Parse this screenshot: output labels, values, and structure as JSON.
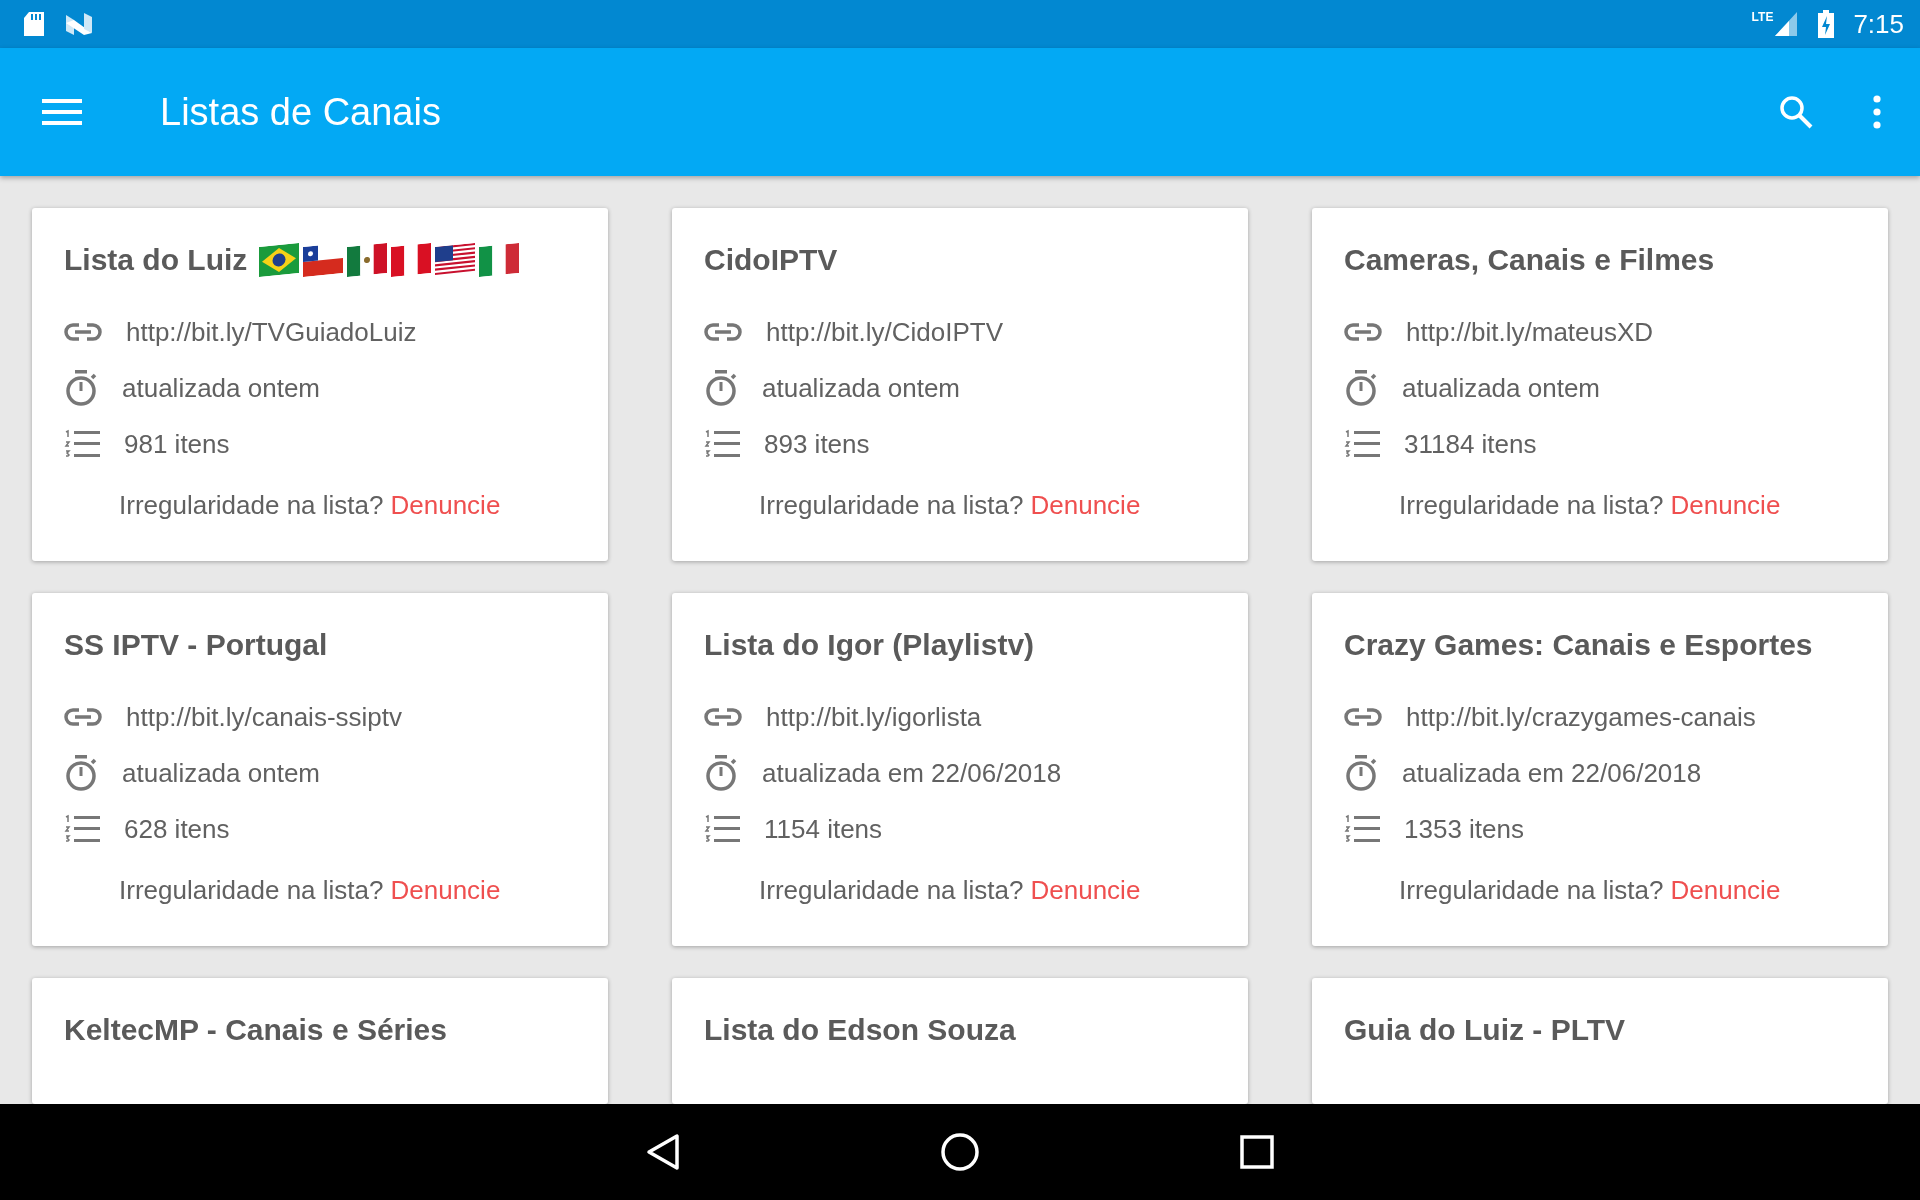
{
  "status_bar": {
    "time": "7:15",
    "network": "LTE"
  },
  "app_bar": {
    "title": "Listas de Canais"
  },
  "cards": [
    {
      "title": "Lista do Luiz",
      "flags": [
        {
          "kind": "brazil"
        },
        {
          "kind": "chile"
        },
        {
          "kind": "mexico"
        },
        {
          "kind": "peru"
        },
        {
          "kind": "usa"
        },
        {
          "kind": "italy"
        }
      ],
      "url": "http://bit.ly/TVGuiadoLuiz",
      "updated": "atualizada ontem",
      "items": "981 itens",
      "report_text": "Irregularidade na lista?",
      "report_link": "Denuncie"
    },
    {
      "title": "CidoIPTV",
      "url": "http://bit.ly/CidoIPTV",
      "updated": "atualizada ontem",
      "items": "893 itens",
      "report_text": "Irregularidade na lista?",
      "report_link": "Denuncie"
    },
    {
      "title": "Cameras, Canais e Filmes",
      "url": "http://bit.ly/mateusXD",
      "updated": "atualizada ontem",
      "items": "31184 itens",
      "report_text": "Irregularidade na lista?",
      "report_link": "Denuncie"
    },
    {
      "title": "SS IPTV - Portugal",
      "url": "http://bit.ly/canais-ssiptv",
      "updated": "atualizada ontem",
      "items": "628 itens",
      "report_text": "Irregularidade na lista?",
      "report_link": "Denuncie"
    },
    {
      "title": "Lista do Igor (Playlistv)",
      "url": "http://bit.ly/igorlista",
      "updated": "atualizada em 22/06/2018",
      "items": "1154 itens",
      "report_text": "Irregularidade na lista?",
      "report_link": "Denuncie"
    },
    {
      "title": "Crazy Games: Canais e Esportes",
      "url": "http://bit.ly/crazygames-canais",
      "updated": "atualizada em 22/06/2018",
      "items": "1353 itens",
      "report_text": "Irregularidade na lista?",
      "report_link": "Denuncie"
    },
    {
      "title": "KeltecMP - Canais e Séries"
    },
    {
      "title": "Lista do Edson Souza"
    },
    {
      "title": "Guia do Luiz - PLTV"
    }
  ]
}
